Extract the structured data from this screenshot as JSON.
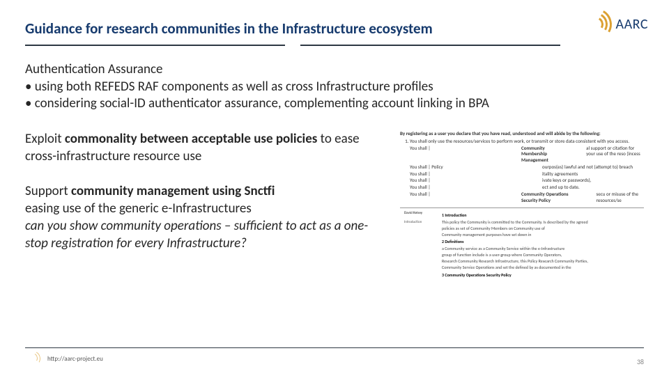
{
  "title": "Guidance for research communities in the Infrastructure ecosystem",
  "logo_text": "AARC",
  "auth": {
    "heading": "Authentication Assurance",
    "b1": "using both REFEDS RAF components as well as cross Infrastructure profiles",
    "b2": "considering social-ID authenticator assurance, complementing account linking in BPA"
  },
  "exploit": {
    "pre": "Exploit ",
    "bold": "commonality between acceptable use policies",
    "post": " to ease cross-infrastructure resource use"
  },
  "support": {
    "l1_pre": "Support ",
    "l1_bold": "community management using Snctfi",
    "l2": "easing use of the generic e-Infrastructures",
    "l3": "can you show community operations – sufficient to act as a one-stop registration for every Infrastructure?"
  },
  "side": {
    "heading": "By registering as a user you declare that you have read, understood and will abide by the following:",
    "items_left": [
      "You shall only use the resources/services to perform work, or transmit or store data consistent with you access.",
      "You shall |",
      "You shall | Policy",
      "You shall |",
      "You shall |",
      "You shall |",
      "You shall |"
    ],
    "items_right": [
      "",
      "Community Membership Management",
      "",
      "",
      "",
      "",
      "Community Operations Security Policy"
    ],
    "items_far": [
      "",
      "al support or citation for your use of the reso (incess",
      "ourpos(es) lawful and not (attempt to) breach",
      "itality agreements",
      "ivate keys or passwords),",
      "ect and up to date.",
      "secu or misuse of the resources/se"
    ]
  },
  "doc": {
    "author": "David Kelsey",
    "h1": "1 Introduction",
    "p1": "This policy the Community is committed to the Community. Is described by the agreed",
    "p2": "policies as set of Community Members on Community use of",
    "p3": "Community management purposes have set down in",
    "h2": "2 Definitions",
    "p4": "a Community service as a Community Service within the e-Infrastructure",
    "p5": "group of function include is a user-group where Community Operators,",
    "p6": "Research Community Research Infrastructure, this Policy Research Community Parties,",
    "p7": "Community Service Operations and set the defined by as documented in the",
    "h3": "3 Community Operations Security Policy"
  },
  "footer_url": "http://aarc-project.eu",
  "page_number": "38"
}
